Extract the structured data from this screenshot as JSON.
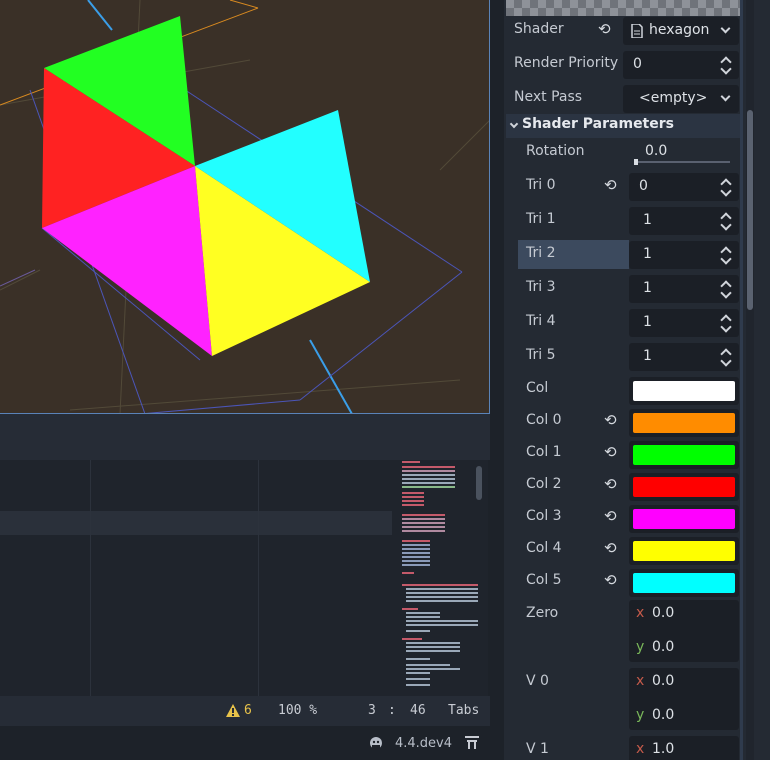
{
  "inspector": {
    "shader": {
      "label": "Shader",
      "value": "hexagon"
    },
    "render_priority": {
      "label": "Render Priority",
      "value": "0"
    },
    "next_pass": {
      "label": "Next Pass",
      "value": "<empty>"
    },
    "section_title": "Shader Parameters",
    "rotation": {
      "label": "Rotation",
      "value": "0.0"
    },
    "tris": [
      {
        "label": "Tri 0",
        "value": "0"
      },
      {
        "label": "Tri 1",
        "value": "1"
      },
      {
        "label": "Tri 2",
        "value": "1"
      },
      {
        "label": "Tri 3",
        "value": "1"
      },
      {
        "label": "Tri 4",
        "value": "1"
      },
      {
        "label": "Tri 5",
        "value": "1"
      }
    ],
    "cols": [
      {
        "label": "Col",
        "color": "#ffffff"
      },
      {
        "label": "Col 0",
        "color": "#ff8c00"
      },
      {
        "label": "Col 1",
        "color": "#00ff00"
      },
      {
        "label": "Col 2",
        "color": "#ff0000"
      },
      {
        "label": "Col 3",
        "color": "#ff00ff"
      },
      {
        "label": "Col 4",
        "color": "#ffff00"
      },
      {
        "label": "Col 5",
        "color": "#00ffff"
      }
    ],
    "zero": {
      "label": "Zero",
      "x": "0.0",
      "y": "0.0"
    },
    "v0": {
      "label": "V 0",
      "x": "0.0",
      "y": "0.0"
    },
    "v1": {
      "label": "V 1",
      "x": "1.0"
    },
    "axis_x": "x",
    "axis_y": "y"
  },
  "statusbar": {
    "warnings": "6",
    "zoom": "100 %",
    "line": "3",
    "sep": ":",
    "col": "46",
    "indent": "Tabs"
  },
  "version": "4.4.dev4",
  "icons": {
    "reset": "reset-icon",
    "warning": "warning-icon",
    "shader": "shader-file-icon",
    "godot": "godot-icon",
    "pin": "pin-icon"
  }
}
